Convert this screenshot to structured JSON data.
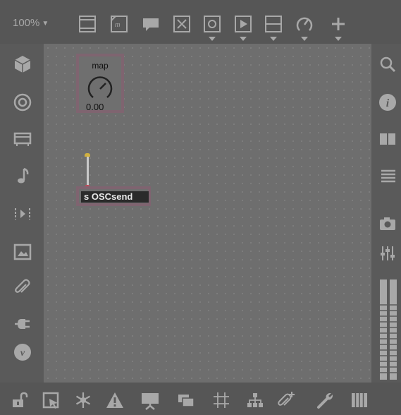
{
  "toolbar": {
    "zoom_label": "100%",
    "icons": [
      "presentation-icon",
      "comment-icon",
      "message-icon",
      "toggle-icon",
      "button-icon",
      "play-icon",
      "slider-icon",
      "dial-icon",
      "add-icon"
    ]
  },
  "left_sidebar": {
    "icons": [
      "package-icon",
      "target-icon",
      "device-icon",
      "music-note-icon",
      "step-icon",
      "image-icon",
      "paperclip-icon",
      "plug-icon",
      "vimeo-icon"
    ]
  },
  "right_sidebar": {
    "icons": [
      "search-icon",
      "info-icon",
      "columns-icon",
      "list-icon",
      "camera-icon",
      "mixer-icon",
      "level-meter-icon"
    ]
  },
  "canvas": {
    "dial": {
      "title": "map",
      "value": "0.00"
    },
    "send_object": {
      "text": "s OSCsend"
    }
  },
  "bottombar": {
    "icons": [
      "lock-icon",
      "edit-select-icon",
      "freeze-icon",
      "warning-icon",
      "presentation-mode-icon",
      "layers-icon",
      "grid-icon",
      "hierarchy-icon",
      "clip-add-icon",
      "wrench-icon",
      "keyboard-icon"
    ]
  },
  "colors": {
    "background": "#5a5a5a",
    "canvas": "#6e6e6e",
    "icon": "#a8a8a8",
    "selection": "#7f6470",
    "outlet": "#d0b040",
    "inlet": "#c04a5a"
  }
}
